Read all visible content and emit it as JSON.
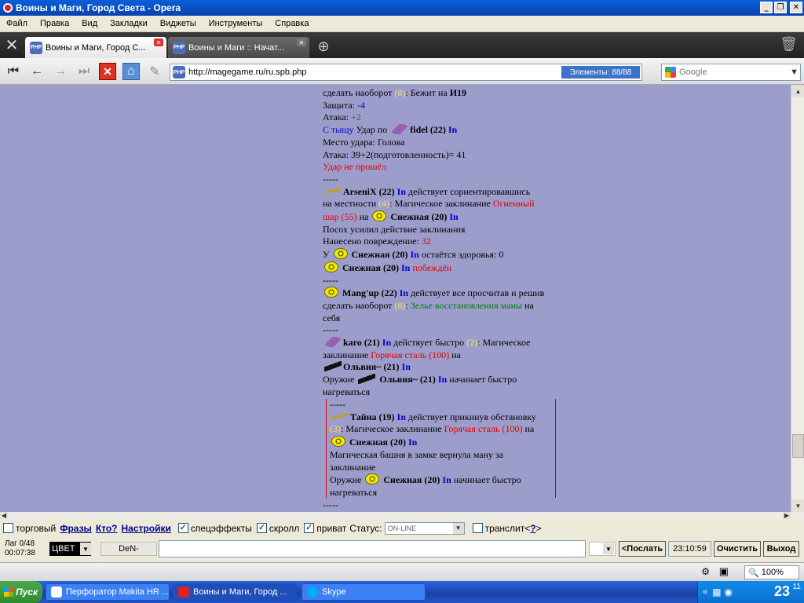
{
  "window": {
    "title": "Воины и Маги, Город Света - Opera"
  },
  "menu": [
    "Файл",
    "Правка",
    "Вид",
    "Закладки",
    "Виджеты",
    "Инструменты",
    "Справка"
  ],
  "tabs": [
    {
      "label": "Воины и Маги, Город С..."
    },
    {
      "label": "Воины и Маги :: Начат..."
    }
  ],
  "address": {
    "url": "http://magegame.ru/ru.spb.php",
    "elements": "Элементы:   88/88"
  },
  "search": {
    "placeholder": "Google"
  },
  "tab_icon_text": "PHP",
  "log": {
    "l1a": "сделать наоборот ",
    "l1n": "(8)",
    "l1b": ": Бежит на ",
    "l1c": "И19",
    "def_label": "Защита: ",
    "def_val": "-4",
    "atk_label": "Атака: ",
    "atk_val": "+2",
    "rear": "С тыщу",
    "hit_by": " Удар по ",
    "fidel": "fidel (22)",
    "in": "In",
    "place": "Место удара: Голова",
    "atk_calc": "Атака: 39+2(подготовленность)= 41",
    "miss": "Удар не прошёл",
    "sep": "-----",
    "arsenix": "ArseniX (22)",
    "arsenix_act": " действует сориентировавшись",
    "terrain": "на местности ",
    "n4": "(4)",
    "magic": ": Магическое заклинание ",
    "fireball": "Огненный",
    "fireball2": "шар (55)",
    "on": " на ",
    "snow": "Снежная (20)",
    "staff": "Посох усилил действие заклинания",
    "dmg_label": "Нанесено повреждение: ",
    "dmg_val": "32",
    "u": "У ",
    "hp_left": " остаётся здоровья: 0",
    "defeated": "побеждён",
    "mangup": "Mang'up (22)",
    "mangup_act": " действует все просчитав и решив",
    "rev": "сделать наоборот ",
    "n8": "(8)",
    "potion": "Зелье восстановления маны",
    "na": " на",
    "self": "себя",
    "karo": "karo (21)",
    "karo_act": " действует быстро ",
    "n2": "(2)",
    "magic2": ": Магическое",
    "spell": "заклинание ",
    "hotsteel": "Горячая сталь (100)",
    "na2": " на",
    "olvia": "Ольвия~ (21)",
    "weapon": "Оружие ",
    "heats": " начинает быстро",
    "heat2": "нагреваться",
    "tayna": "Тайна (19)",
    "tayna_act": " действует прикинув обстановку",
    "n3": "(3)",
    "magic3": ": Магическое заклинание ",
    "na3": " на",
    "tower": "Магическая башня в замке вернула ману за",
    "spell_word": "заклинание"
  },
  "chat": {
    "trade": "торговый",
    "phrases": "Фразы",
    "who": "Кто?",
    "settings": "Настройки",
    "effects": "спецэффекты",
    "scroll": "скролл",
    "private": "приват",
    "status_label": "Статус:",
    "status_value": "ON-LINE",
    "translit": "транслит<",
    "translit_q": "?",
    "translit_end": ">",
    "lag": "Лаг 0/48",
    "time": "00:07:38",
    "color": "ЦВЕТ",
    "nick": "DeN-",
    "send": "<Послать",
    "clock": "23:10:59",
    "clear": "Очистить",
    "exit": "Выход"
  },
  "statusbar": {
    "zoom": "100%"
  },
  "taskbar": {
    "start": "Пуск",
    "items": [
      "Перфоратор Makita HR ...",
      "Воины и Маги, Город ...",
      "Skype"
    ],
    "time": "23",
    "time_min": "11",
    "tray_arrow": "«"
  },
  "colors": {
    "page_bg": "#9d9dcc",
    "nick_blue": "#0000cc",
    "red": "#e00000",
    "green": "#008000",
    "num_yellow": "#f5e35a"
  }
}
